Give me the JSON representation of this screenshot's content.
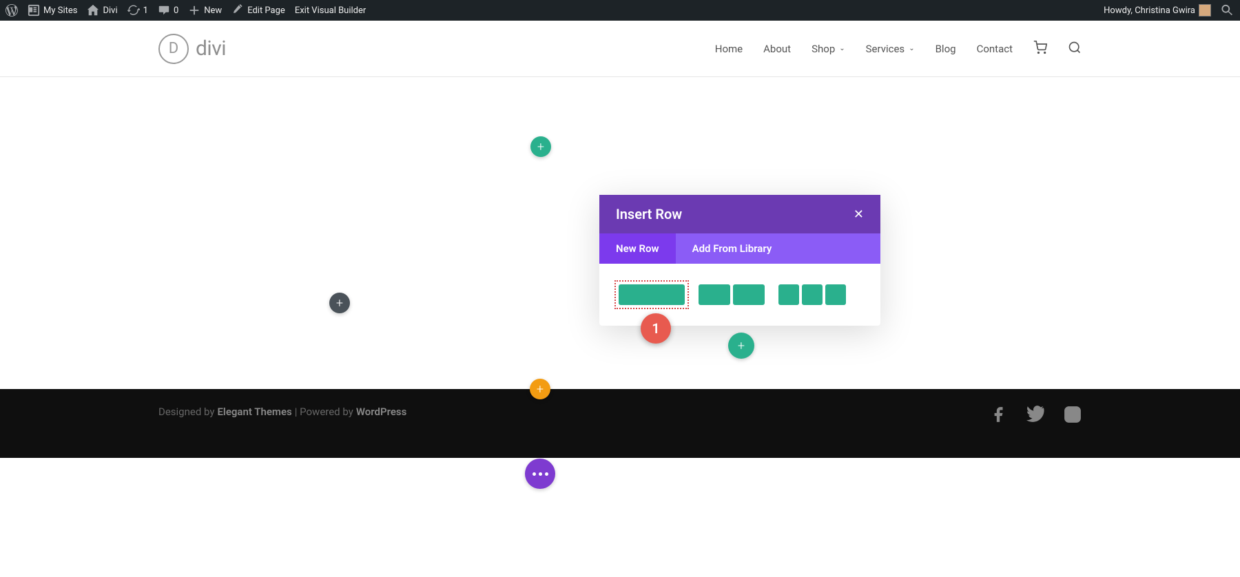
{
  "wp_bar": {
    "my_sites": "My Sites",
    "site_name": "Divi",
    "updates_count": "1",
    "comments_count": "0",
    "new_label": "New",
    "edit_page": "Edit Page",
    "exit_vb": "Exit Visual Builder",
    "howdy": "Howdy, Christina Gwira"
  },
  "site": {
    "logo_letter": "D",
    "logo_text": "divi",
    "nav": {
      "home": "Home",
      "about": "About",
      "shop": "Shop",
      "services": "Services",
      "blog": "Blog",
      "contact": "Contact"
    }
  },
  "modal": {
    "title": "Insert Row",
    "tab_new": "New Row",
    "tab_library": "Add From Library"
  },
  "annotation": {
    "badge_1": "1"
  },
  "footer": {
    "designed_by": "Designed by ",
    "theme": "Elegant Themes",
    "sep": " | Powered by ",
    "platform": "WordPress"
  },
  "glyphs": {
    "plus": "+",
    "close": "✕",
    "chevron": "⌄"
  }
}
